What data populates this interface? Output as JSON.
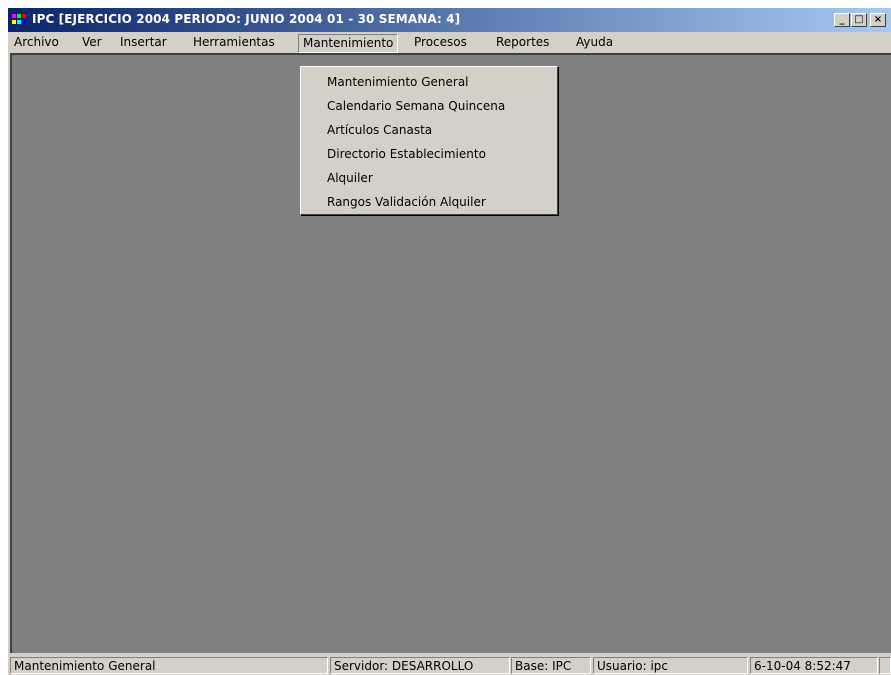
{
  "window": {
    "title": "IPC [EJERCICIO 2004 PERIODO: JUNIO 2004 01 - 30 SEMANA: 4]",
    "minimize": "_",
    "maximize": "□",
    "close": "×"
  },
  "menubar": {
    "items": [
      "Archivo",
      "Ver",
      "Insertar",
      "Herramientas",
      "Mantenimiento",
      "Procesos",
      "Reportes",
      "Ayuda"
    ],
    "open_menu": "Mantenimiento"
  },
  "dropdown": {
    "items": [
      "Mantenimiento General",
      "Calendario Semana Quincena",
      "Artículos Canasta",
      "Directorio Establecimiento",
      "Alquiler",
      "Rangos Validación Alquiler"
    ]
  },
  "statusbar": {
    "message": "Mantenimiento General",
    "server": "Servidor: DESARROLLO",
    "base": "Base: IPC",
    "user": "Usuario: ipc",
    "datetime": "6-10-04 8:52:47"
  },
  "colors": {
    "titlebar_start": "#0a246a",
    "titlebar_end": "#a6caf0",
    "mdi_background": "#808080",
    "chrome": "#d4d0c8"
  }
}
